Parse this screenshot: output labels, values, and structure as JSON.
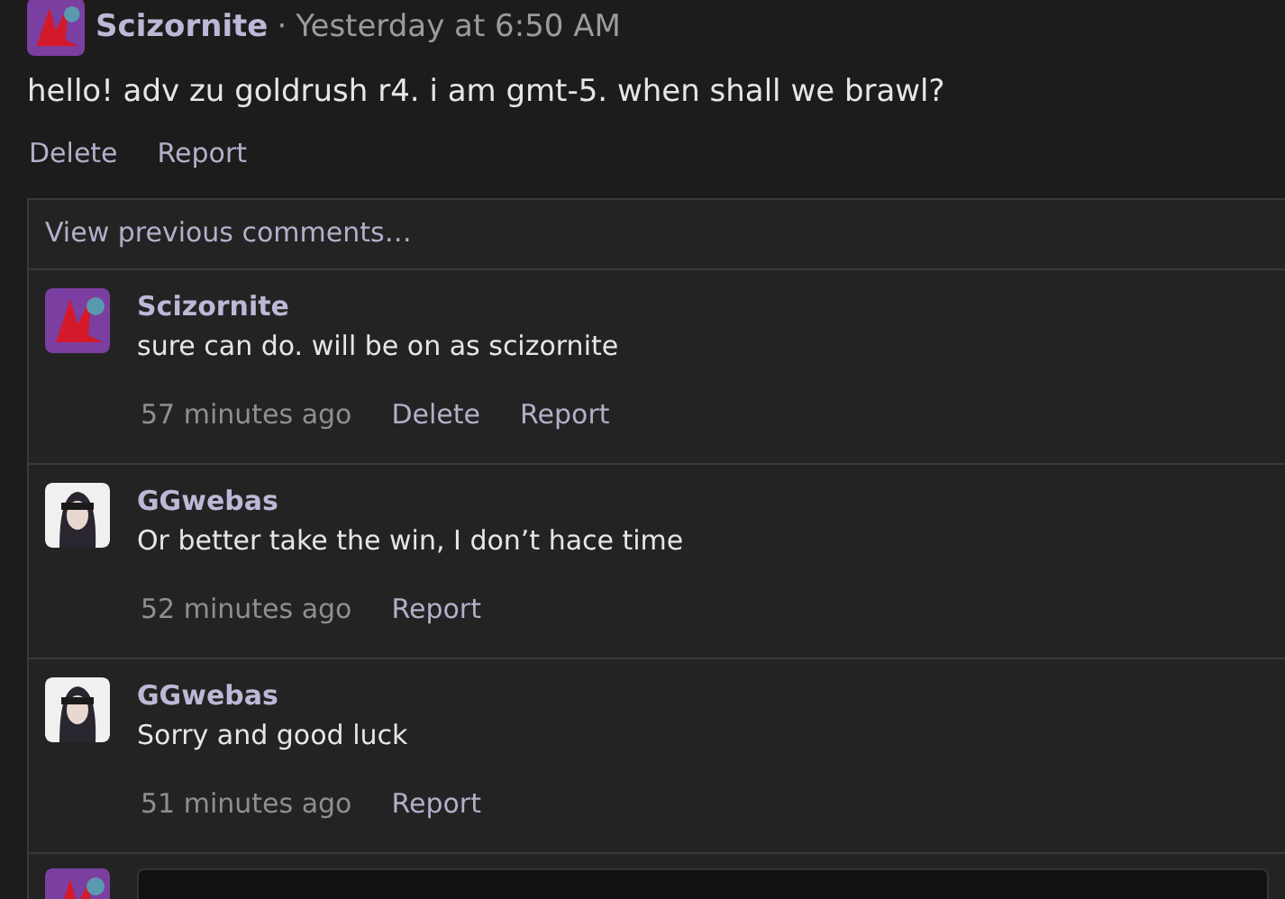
{
  "post": {
    "author": "Scizornite",
    "separator": "·",
    "time": "Yesterday at 6:50 AM",
    "text": "hello! adv zu goldrush r4. i am gmt-5. when shall we brawl?",
    "actions": [
      "Delete",
      "Report"
    ]
  },
  "comments": {
    "view_previous": "View previous comments…",
    "items": [
      {
        "author": "Scizornite",
        "kind": "creature",
        "text": "sure can do. will be on as scizornite",
        "time": "57 minutes ago",
        "actions": [
          "Delete",
          "Report"
        ]
      },
      {
        "author": "GGwebas",
        "kind": "hooded",
        "text": "Or better take the win, I don’t hace time",
        "time": "52 minutes ago",
        "actions": [
          "Report"
        ]
      },
      {
        "author": "GGwebas",
        "kind": "hooded",
        "text": "Sorry and good luck",
        "time": "51 minutes ago",
        "actions": [
          "Report"
        ]
      }
    ]
  }
}
